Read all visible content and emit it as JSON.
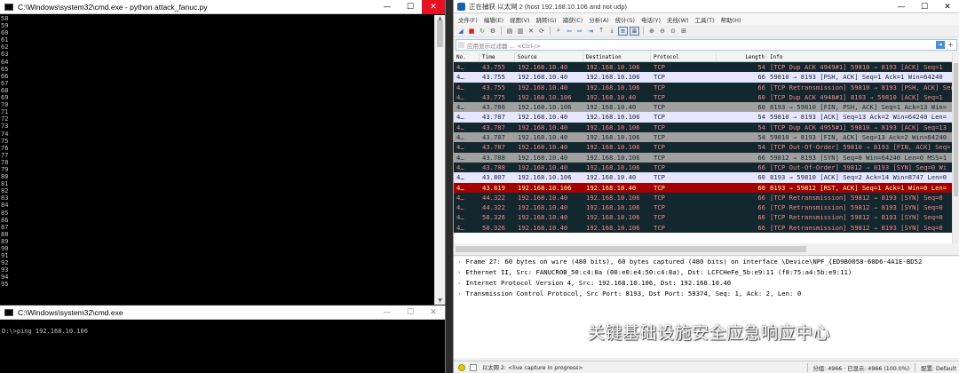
{
  "cmd1": {
    "title": "C:\\Windows\\system32\\cmd.exe - python  attack_fanuc.py",
    "lines": [
      "58",
      "59",
      "60",
      "61",
      "62",
      "63",
      "64",
      "65",
      "66",
      "67",
      "68",
      "69",
      "70",
      "71",
      "72",
      "73",
      "74",
      "75",
      "76",
      "77",
      "78",
      "79",
      "80",
      "81",
      "82",
      "83",
      "84",
      "85",
      "86",
      "87",
      "88",
      "89",
      "90",
      "91",
      "92",
      "93",
      "94",
      "95"
    ],
    "buttons": {
      "minimize": "—",
      "maximize": "☐",
      "close": "✕"
    }
  },
  "cmd2": {
    "title": "C:\\Windows\\system32\\cmd.exe",
    "prompt": "D:\\>ping 192.168.10.106",
    "buttons": {
      "minimize": "—",
      "maximize": "☐",
      "close": "✕"
    }
  },
  "wireshark": {
    "title": "正在捕获 以太网 2 (host 192.168.10.106 and not udp)",
    "buttons": {
      "minimize": "—",
      "maximize": "☐",
      "close": "✕"
    },
    "menu": [
      "文件(F)",
      "编辑(E)",
      "视图(V)",
      "跳转(G)",
      "捕获(C)",
      "分析(A)",
      "统计(S)",
      "电话(Y)",
      "无线(W)",
      "工具(T)",
      "帮助(H)"
    ],
    "filter_placeholder": "应用显示过滤器 … <Ctrl-/>",
    "columns": [
      "No.",
      "Time",
      "Source",
      "Destination",
      "Protocol",
      "Length",
      "Info"
    ],
    "packets": [
      {
        "no": "4…",
        "time": "43.755",
        "src": "192.168.10.40",
        "dst": "192.168.10.106",
        "proto": "TCP",
        "len": "54",
        "info": "[TCP Dup ACK 4949#1] 59810 → 8193 [ACK] Seq=1",
        "style": "dark"
      },
      {
        "no": "4…",
        "time": "43.755",
        "src": "192.168.10.40",
        "dst": "192.168.10.106",
        "proto": "TCP",
        "len": "66",
        "info": "59810 → 8193 [PSH, ACK] Seq=1 Ack=1 Win=64240",
        "style": "light"
      },
      {
        "no": "4…",
        "time": "43.755",
        "src": "192.168.10.40",
        "dst": "192.168.10.106",
        "proto": "TCP",
        "len": "66",
        "info": "[TCP Retransmission] 59810 → 8193 [PSH, ACK] Seq=1",
        "style": "dark"
      },
      {
        "no": "4…",
        "time": "43.775",
        "src": "192.168.10.106",
        "dst": "192.168.10.40",
        "proto": "TCP",
        "len": "60",
        "info": "[TCP Dup ACK 4948#1] 8193 → 59810 [ACK] Seq=1",
        "style": "dark"
      },
      {
        "no": "4…",
        "time": "43.786",
        "src": "192.168.10.106",
        "dst": "192.168.10.40",
        "proto": "TCP",
        "len": "60",
        "info": "8193 → 59810 [FIN, PSH, ACK] Seq=1 Ack=13 Win=",
        "style": "gray"
      },
      {
        "no": "4…",
        "time": "43.787",
        "src": "192.168.10.40",
        "dst": "192.168.10.106",
        "proto": "TCP",
        "len": "54",
        "info": "59810 → 8193 [ACK] Seq=13 Ack=2 Win=64240 Len=",
        "style": "light"
      },
      {
        "no": "4…",
        "time": "43.787",
        "src": "192.168.10.40",
        "dst": "192.168.10.106",
        "proto": "TCP",
        "len": "54",
        "info": "[TCP Dup ACK 4955#1] 59810 → 8193 [ACK] Seq=13",
        "style": "dark"
      },
      {
        "no": "4…",
        "time": "43.787",
        "src": "192.168.10.40",
        "dst": "192.168.10.106",
        "proto": "TCP",
        "len": "54",
        "info": "59810 → 8193 [FIN, ACK] Seq=13 Ack=2 Win=64240",
        "style": "gray"
      },
      {
        "no": "4…",
        "time": "43.787",
        "src": "192.168.10.40",
        "dst": "192.168.10.106",
        "proto": "TCP",
        "len": "54",
        "info": "[TCP Out-Of-Order] 59810 → 8193 [FIN, ACK] Seq=",
        "style": "dark"
      },
      {
        "no": "4…",
        "time": "43.788",
        "src": "192.168.10.40",
        "dst": "192.168.10.106",
        "proto": "TCP",
        "len": "66",
        "info": "59812 → 8193 [SYN] Seq=0 Win=64240 Len=0 MSS=1",
        "style": "gray"
      },
      {
        "no": "4…",
        "time": "43.788",
        "src": "192.168.10.40",
        "dst": "192.168.10.106",
        "proto": "TCP",
        "len": "66",
        "info": "[TCP Out-Of-Order] 59812 → 8193 [SYN] Seq=0 Wi",
        "style": "dark"
      },
      {
        "no": "4…",
        "time": "43.807",
        "src": "192.168.10.106",
        "dst": "192.168.10.40",
        "proto": "TCP",
        "len": "60",
        "info": "8193 → 59810 [ACK] Seq=2 Ack=14 Win=8747 Len=0",
        "style": "light"
      },
      {
        "no": "4…",
        "time": "43.819",
        "src": "192.168.10.106",
        "dst": "192.168.10.40",
        "proto": "TCP",
        "len": "60",
        "info": "8193 → 59812 [RST, ACK] Seq=1 Ack=1 Win=0 Len=",
        "style": "red"
      },
      {
        "no": "4…",
        "time": "44.322",
        "src": "192.168.10.40",
        "dst": "192.168.10.106",
        "proto": "TCP",
        "len": "66",
        "info": "[TCP Retransmission] 59812 → 8193 [SYN] Seq=0",
        "style": "dark"
      },
      {
        "no": "4…",
        "time": "44.322",
        "src": "192.168.10.40",
        "dst": "192.168.10.106",
        "proto": "TCP",
        "len": "66",
        "info": "[TCP Retransmission] 59812 → 8193 [SYN] Seq=0",
        "style": "dark"
      },
      {
        "no": "4…",
        "time": "50.326",
        "src": "192.168.10.40",
        "dst": "192.168.10.106",
        "proto": "TCP",
        "len": "66",
        "info": "[TCP Retransmission] 59812 → 8193 [SYN] Seq=0",
        "style": "dark"
      },
      {
        "no": "4…",
        "time": "50.326",
        "src": "192.168.10.40",
        "dst": "192.168.10.106",
        "proto": "TCP",
        "len": "66",
        "info": "[TCP Retransmission] 59812 → 8193 [SYN] Seq=0",
        "style": "dark"
      }
    ],
    "details": [
      "Frame 27: 60 bytes on wire (480 bits), 60 bytes captured (480 bits) on interface \\Device\\NPF_{ED9B0058-60D6-4A1E-BD52",
      "Ethernet II, Src: FANUCROB_50:c4:8a (00:e0:e4:50:c4:8a), Dst: LCFCHeFe_5b:e9:11 (f8:75:a4:5b:e9:11)",
      "Internet Protocol Version 4, Src: 192.168.10.106, Dst: 192.168.10.40",
      "Transmission Control Protocol, Src Port: 8193, Dst Port: 59374, Seq: 1, Ack: 2, Len: 0"
    ],
    "status": {
      "interface": "以太网 2: <live capture in progress>",
      "packets": "分组: 4966 · 已显示: 4966 (100.0%)",
      "profile": "配置: Default"
    }
  },
  "watermark": {
    "text": "关键基础设施安全应急响应中心"
  }
}
